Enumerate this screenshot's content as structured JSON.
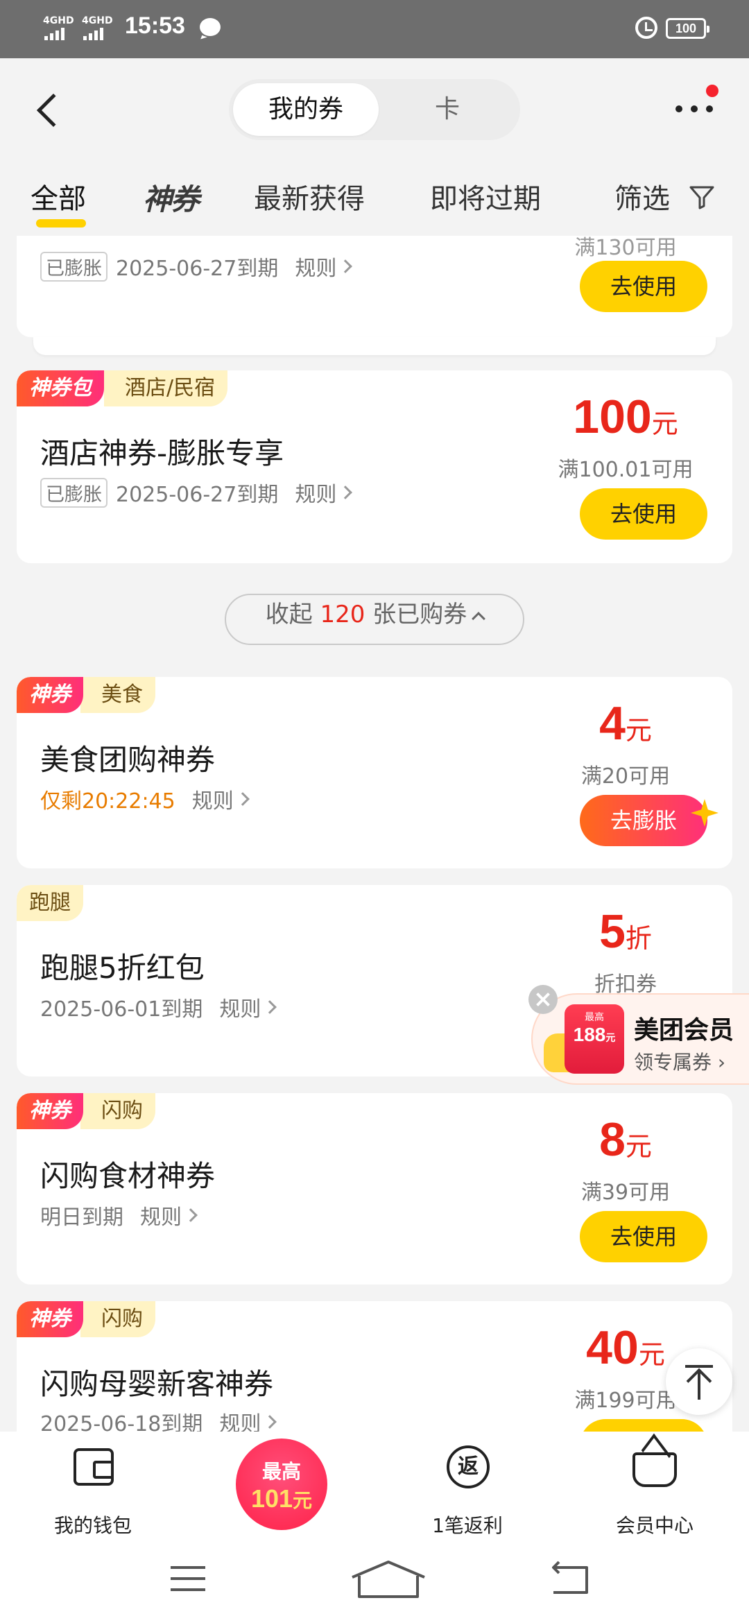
{
  "status_bar": {
    "time": "15:53",
    "network1": "4GHD",
    "network2": "4GHD",
    "battery": "100"
  },
  "header": {
    "seg_active": "我的券",
    "seg_inactive": "卡"
  },
  "tabs": [
    "全部",
    "神券",
    "最新获得",
    "即将过期",
    "筛选"
  ],
  "partial_card": {
    "badge": "已膨胀",
    "expiry": "2025-06-27到期",
    "rule": "规则",
    "condition": "满130可用",
    "button": "去使用"
  },
  "cards": [
    {
      "brand_tag": "神券包",
      "cat_tag": "酒店/民宿",
      "title": "酒店神券-膨胀专享",
      "badge": "已膨胀",
      "expiry": "2025-06-27到期",
      "rule": "规则",
      "amount": "100",
      "unit": "元",
      "condition": "满100.01可用",
      "button": "去使用"
    },
    {
      "brand_tag": "神券",
      "cat_tag": "美食",
      "title": "美食团购神券",
      "timer": "仅剩20:22:45",
      "rule": "规则",
      "amount": "4",
      "unit": "元",
      "condition": "满20可用",
      "button": "去膨胀"
    },
    {
      "cat_tag": "跑腿",
      "title": "跑腿5折红包",
      "expiry": "2025-06-01到期",
      "rule": "规则",
      "amount": "5",
      "unit": "折",
      "condition": "折扣券"
    },
    {
      "brand_tag": "神券",
      "cat_tag": "闪购",
      "title": "闪购食材神券",
      "expiry": "明日到期",
      "rule": "规则",
      "amount": "8",
      "unit": "元",
      "condition": "满39可用",
      "button": "去使用"
    },
    {
      "brand_tag": "神券",
      "cat_tag": "闪购",
      "title": "闪购母婴新客神券",
      "expiry": "2025-06-18到期",
      "rule": "规则",
      "amount": "40",
      "unit": "元",
      "condition": "满199可用"
    }
  ],
  "collapse": {
    "prefix": "收起",
    "count": "120",
    "suffix": "张已购券"
  },
  "member": {
    "coupon_top": "最高",
    "coupon_value": "188",
    "coupon_unit": "元",
    "title": "美团会员",
    "subtitle": "领专属券"
  },
  "bottom_nav": {
    "wallet": "我的钱包",
    "promo_top": "最高",
    "promo_value": "101",
    "promo_unit": "元",
    "return_glyph": "返",
    "return_label": "1笔返利",
    "member_center": "会员中心"
  }
}
